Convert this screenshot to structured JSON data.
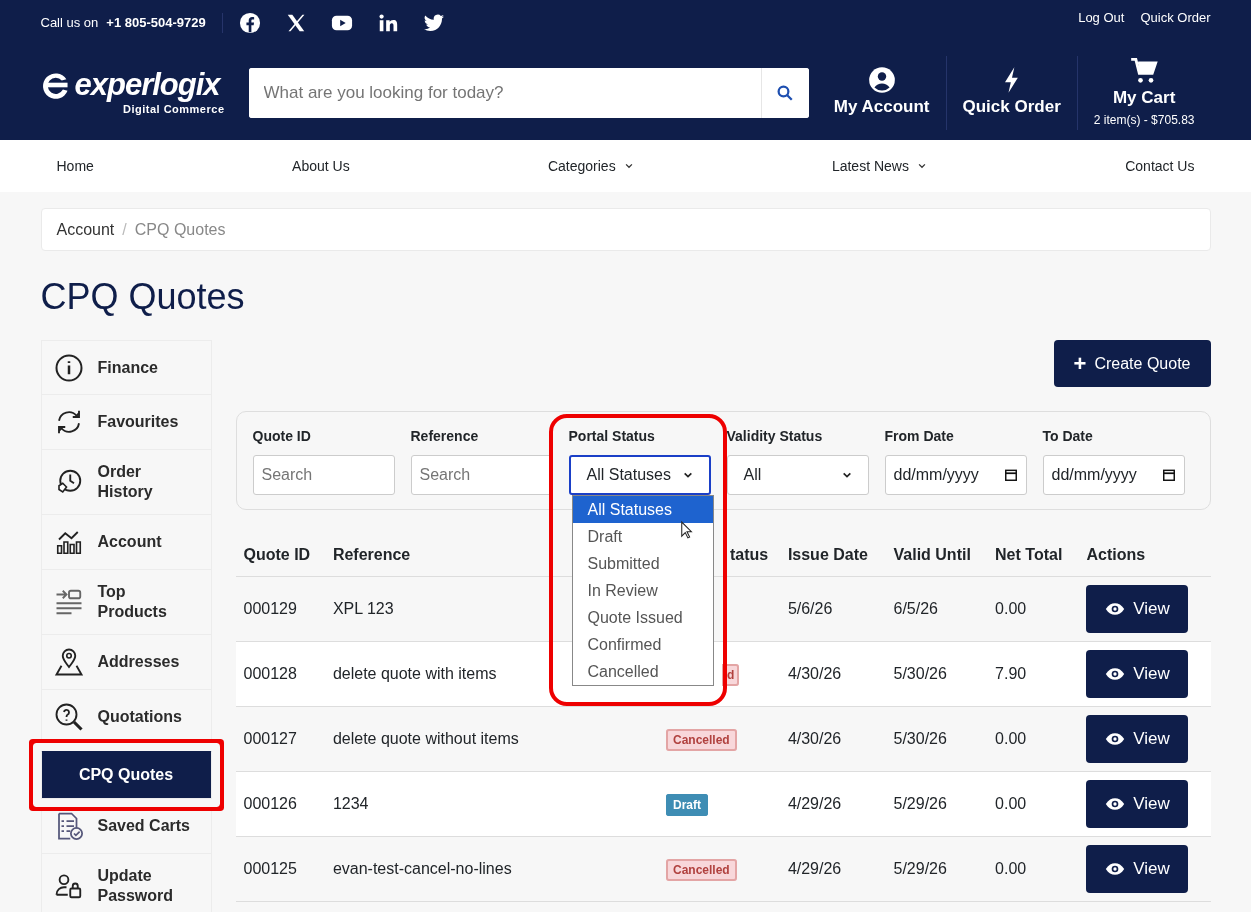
{
  "topbar": {
    "call_label": "Call us on",
    "phone": "+1 805-504-9729",
    "links": [
      "Log Out",
      "Quick Order"
    ]
  },
  "header": {
    "logo": {
      "name": "experlogix",
      "tagline": "Digital Commerce"
    },
    "search": {
      "placeholder": "What are you looking for today?"
    },
    "actions": [
      {
        "kind": "account",
        "label": "My Account"
      },
      {
        "kind": "bolt",
        "label": "Quick Order"
      },
      {
        "kind": "cart",
        "label": "My Cart",
        "detail": "2 item(s) - $705.83"
      }
    ]
  },
  "nav": [
    {
      "label": "Home",
      "dropdown": false
    },
    {
      "label": "About Us",
      "dropdown": false
    },
    {
      "label": "Categories",
      "dropdown": true
    },
    {
      "label": "Latest News",
      "dropdown": true
    },
    {
      "label": "Contact Us",
      "dropdown": false
    }
  ],
  "breadcrumb": {
    "items": [
      "Account",
      "CPQ Quotes"
    ],
    "separator": "/"
  },
  "page_title": "CPQ Quotes",
  "sidebar": {
    "items": [
      {
        "label": "Finance",
        "selected": false,
        "highlighted": false
      },
      {
        "label": "Favourites",
        "selected": false,
        "highlighted": false
      },
      {
        "label": "Order History",
        "selected": false,
        "highlighted": false
      },
      {
        "label": "Account",
        "selected": false,
        "highlighted": false
      },
      {
        "label": "Top Products",
        "selected": false,
        "highlighted": false
      },
      {
        "label": "Addresses",
        "selected": false,
        "highlighted": false
      },
      {
        "label": "Quotations",
        "selected": false,
        "highlighted": false
      },
      {
        "label": "CPQ Quotes",
        "selected": true,
        "highlighted": true
      },
      {
        "label": "Saved Carts",
        "selected": false,
        "highlighted": false
      },
      {
        "label": "Update Password",
        "selected": false,
        "highlighted": false
      }
    ]
  },
  "create_button": {
    "icon": "+",
    "label": "Create Quote"
  },
  "filters": [
    {
      "kind": "text",
      "label": "Quote ID",
      "placeholder": "Search",
      "highlighted": false
    },
    {
      "kind": "text",
      "label": "Reference",
      "placeholder": "Search",
      "highlighted": false
    },
    {
      "kind": "select",
      "label": "Portal Status",
      "value": "All Statuses",
      "highlighted": true,
      "open": true,
      "options": [
        {
          "label": "All Statuses",
          "selected": true
        },
        {
          "label": "Draft",
          "selected": false
        },
        {
          "label": "Submitted",
          "selected": false
        },
        {
          "label": "In Review",
          "selected": false
        },
        {
          "label": "Quote Issued",
          "selected": false
        },
        {
          "label": "Confirmed",
          "selected": false
        },
        {
          "label": "Cancelled",
          "selected": false
        }
      ]
    },
    {
      "kind": "select",
      "label": "Validity Status",
      "value": "All",
      "highlighted": false,
      "open": false
    },
    {
      "kind": "date",
      "label": "From Date",
      "placeholder": "dd/mm/yyyy",
      "highlighted": false
    },
    {
      "kind": "date",
      "label": "To Date",
      "placeholder": "dd/mm/yyyy",
      "highlighted": false
    }
  ],
  "table": {
    "columns": [
      "Quote ID",
      "Reference",
      "tatus",
      "Issue Date",
      "Valid Until",
      "Net Total",
      "Actions"
    ],
    "rows": [
      {
        "quote_id": "000129",
        "reference": "XPL 123",
        "issue_date": "5/6/26",
        "valid_until": "6/5/26",
        "net_total": "0.00",
        "action": "View"
      },
      {
        "quote_id": "000128",
        "reference": "delete quote with items",
        "status": {
          "text": "d",
          "kind": "cancelled"
        },
        "issue_date": "4/30/26",
        "valid_until": "5/30/26",
        "net_total": "7.90",
        "action": "View"
      },
      {
        "quote_id": "000127",
        "reference": "delete quote without items",
        "status": {
          "text": "Cancelled",
          "kind": "cancelled"
        },
        "issue_date": "4/30/26",
        "valid_until": "5/30/26",
        "net_total": "0.00",
        "action": "View"
      },
      {
        "quote_id": "000126",
        "reference": "1234",
        "status": {
          "text": "Draft",
          "kind": "draft"
        },
        "issue_date": "4/29/26",
        "valid_until": "5/29/26",
        "net_total": "0.00",
        "action": "View"
      },
      {
        "quote_id": "000125",
        "reference": "evan-test-cancel-no-lines",
        "status": {
          "text": "Cancelled",
          "kind": "cancelled"
        },
        "issue_date": "4/29/26",
        "valid_until": "5/29/26",
        "net_total": "0.00",
        "action": "View"
      }
    ]
  }
}
